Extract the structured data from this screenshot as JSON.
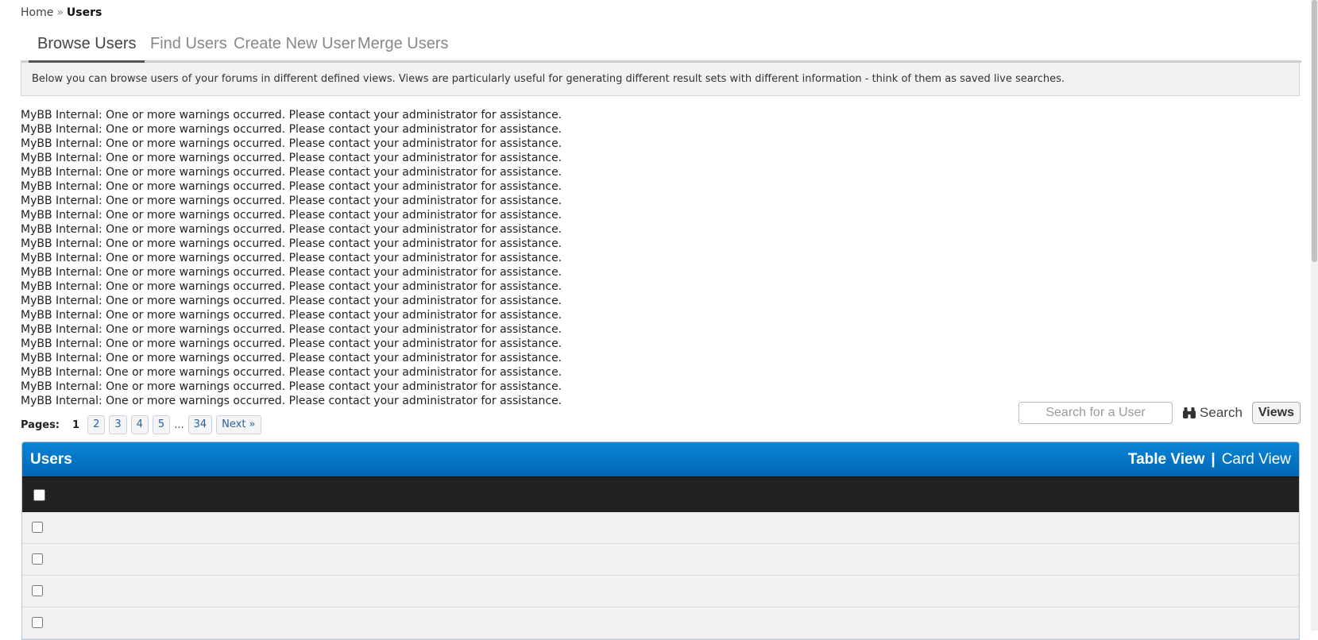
{
  "breadcrumb": {
    "home": "Home",
    "separator": "»",
    "current": "Users"
  },
  "tabs": [
    {
      "label": "Browse Users",
      "active": true
    },
    {
      "label": "Find Users",
      "active": false
    },
    {
      "label": "Create New User",
      "active": false
    },
    {
      "label": "Merge Users",
      "active": false
    }
  ],
  "info_text": "Below you can browse users of your forums in different defined views. Views are particularly useful for generating different result sets with different information - think of them as saved live searches.",
  "warning_text": "MyBB Internal: One or more warnings occurred. Please contact your administrator for assistance.",
  "warning_count": 21,
  "pagination": {
    "label": "Pages:",
    "current": "1",
    "pages": [
      "2",
      "3",
      "4",
      "5"
    ],
    "ellipsis": "...",
    "last": "34",
    "next": "Next »"
  },
  "search": {
    "placeholder": "Search for a User",
    "button": "Search",
    "views_button": "Views"
  },
  "panel": {
    "title": "Users",
    "table_view": "Table View",
    "separator": "|",
    "card_view": "Card View"
  },
  "rows_visible": 4,
  "colors": {
    "header_blue": "#0b85d6",
    "table_header": "#222222",
    "row_bg": "#f1f1f1"
  }
}
